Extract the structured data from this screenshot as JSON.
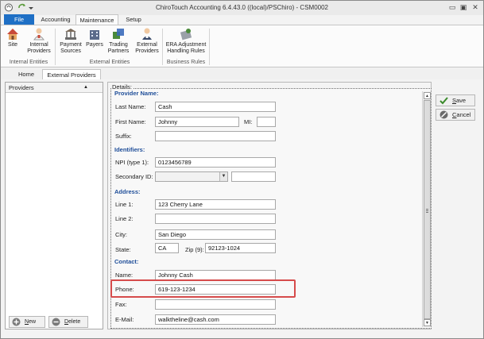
{
  "window": {
    "title": "ChiroTouch Accounting 6.4.43.0 ((local)/PSChiro) - CSM0002",
    "minimize": "▭",
    "restore": "▣",
    "close": "✕"
  },
  "ribbon": {
    "tabs": [
      "File",
      "Accounting",
      "Maintenance",
      "Setup"
    ],
    "active_tab": "Maintenance",
    "buttons": {
      "site": "Site",
      "internal_providers": [
        "Internal",
        "Providers"
      ],
      "payment_sources": [
        "Payment",
        "Sources"
      ],
      "payers": "Payers",
      "trading_partners": [
        "Trading",
        "Partners"
      ],
      "external_providers": [
        "External",
        "Providers"
      ],
      "era_adjustment": [
        "ERA Adjustment",
        "Handling Rules"
      ]
    },
    "groups": {
      "internal_entities": "Internal Entities",
      "external_entities": "External Entities",
      "business_rules": "Business Rules"
    }
  },
  "doc_tabs": [
    "Home",
    "External Providers"
  ],
  "left_panel": {
    "header": "Providers",
    "sort_icon": "▲",
    "new_label_first": "N",
    "new_label_rest": "ew",
    "delete_label_first": "D",
    "delete_label_rest": "elete"
  },
  "actions": {
    "save_first": "S",
    "save_rest": "ave",
    "cancel_first": "C",
    "cancel_rest": "ancel"
  },
  "details": {
    "group_label": "Details:",
    "sections": {
      "provider_name": "Provider Name:",
      "identifiers": "Identifiers:",
      "address": "Address:",
      "contact": "Contact:"
    },
    "labels": {
      "last_name": "Last Name:",
      "first_name": "First Name:",
      "mi": "MI:",
      "suffix": "Suffix:",
      "npi": "NPI (type 1):",
      "secondary_id": "Secondary ID:",
      "line1": "Line 1:",
      "line2": "Line 2:",
      "city": "City:",
      "state": "State:",
      "zip": "Zip (9):",
      "name": "Name:",
      "phone": "Phone:",
      "fax": "Fax:",
      "email": "E-Mail:"
    },
    "values": {
      "last_name": "Cash",
      "first_name": "Johnny",
      "mi": "",
      "suffix": "",
      "npi": "0123456789",
      "secondary_id_type": "",
      "secondary_id": "",
      "line1": "123 Cherry Lane",
      "line2": "",
      "city": "San Diego",
      "state": "CA",
      "zip": "92123-1024",
      "contact_name": "Johnny Cash",
      "phone": "619-123-1234",
      "fax": "",
      "email": "walktheline@cash.com"
    }
  },
  "colors": {
    "file_tab": "#1e6fc5",
    "section_heading": "#1f4e99",
    "highlight": "#d64b4b"
  }
}
